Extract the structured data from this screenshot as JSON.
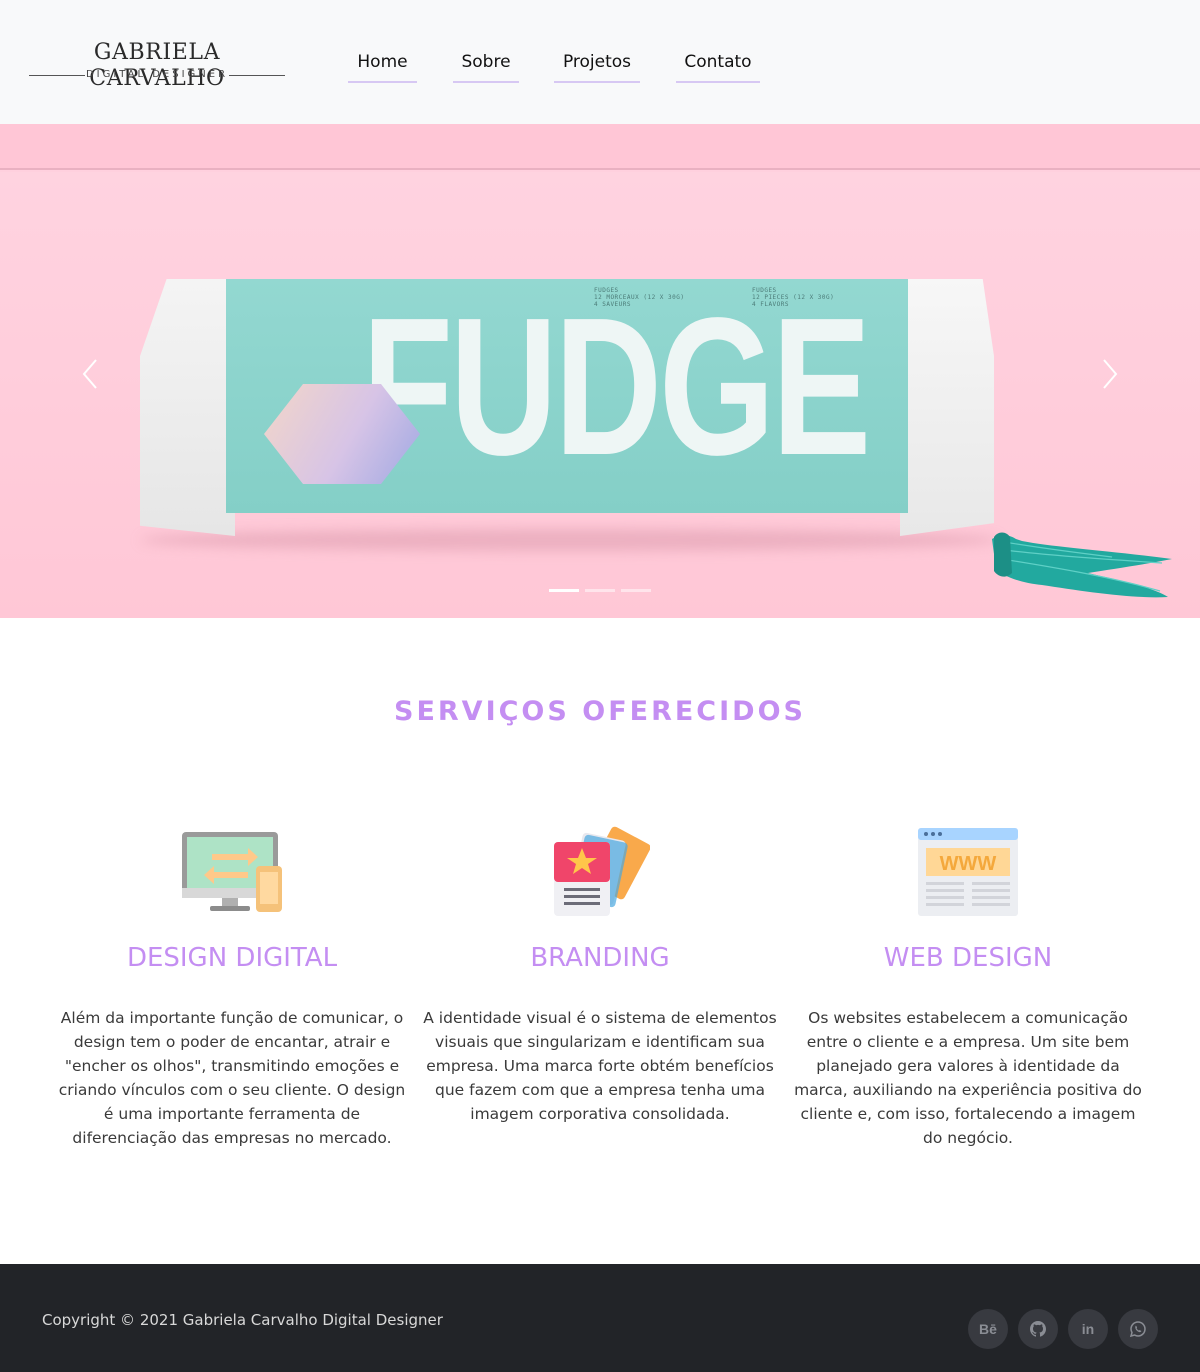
{
  "logo": {
    "name": "GABRIELA CARVALHO",
    "subtitle": "DIGITAL DESIGNER"
  },
  "nav": {
    "items": [
      {
        "label": "Home"
      },
      {
        "label": "Sobre"
      },
      {
        "label": "Projetos"
      },
      {
        "label": "Contato"
      }
    ]
  },
  "hero": {
    "product_word": "FUDGE",
    "label_left": "FUDGES\n12 MORCEAUX (12 X 30G)\n4 SAVEURS",
    "label_right": "FUDGES\n12 PIECES (12 X 30G)\n4 FLAVORS",
    "slides_total": 3,
    "active_slide": 1,
    "prev_icon": "chevron-left-icon",
    "next_icon": "chevron-right-icon"
  },
  "services": {
    "title": "SERVIÇOS OFERECIDOS",
    "items": [
      {
        "icon": "devices-sync-icon",
        "title": "DESIGN DIGITAL",
        "text": "Além da importante função de comunicar, o design tem o poder de encantar, atrair e \"encher os olhos\", transmitindo emoções e criando vínculos com o seu cliente. O design é uma importante ferramenta de diferenciação das empresas no mercado."
      },
      {
        "icon": "branding-cards-icon",
        "title": "BRANDING",
        "text": "A identidade visual é o sistema de elementos visuais que singularizam e identificam sua empresa. Uma marca forte obtém benefícios que fazem com que a empresa tenha uma imagem corporativa consolidada."
      },
      {
        "icon": "website-www-icon",
        "title": "WEB DESIGN",
        "text": "Os websites estabelecem a comunicação entre o cliente e a empresa. Um site bem planejado gera valores à identidade da marca, auxiliando na experiência positiva do cliente e, com isso, fortalecendo a imagem do negócio."
      }
    ]
  },
  "footer": {
    "copyright": "Copyright © 2021 Gabriela Carvalho Digital Designer",
    "social": [
      {
        "icon": "behance-icon",
        "glyph": "Bē"
      },
      {
        "icon": "github-icon"
      },
      {
        "icon": "linkedin-icon",
        "glyph": "in"
      },
      {
        "icon": "whatsapp-icon"
      }
    ]
  },
  "colors": {
    "accent": "#c48ef2",
    "nav_underline": "#d7c8f3",
    "hero_background": "#ffd0de",
    "footer_background": "#222428",
    "header_background": "#f8f9fa"
  }
}
